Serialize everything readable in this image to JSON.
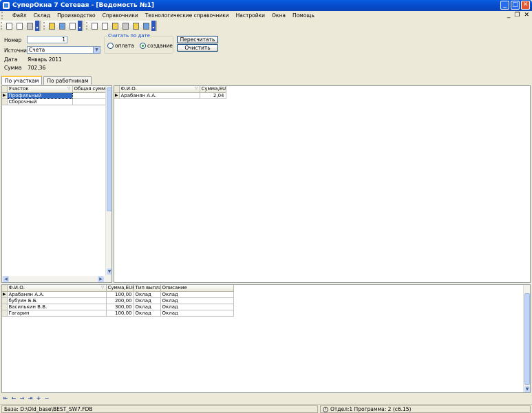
{
  "window": {
    "title": "СуперОкна 7 Сетевая - [Ведомость №1]",
    "minimize": "_",
    "maximize": "□",
    "close": "✕",
    "mdi_min": "_",
    "mdi_restore": "❐",
    "mdi_close": "✕"
  },
  "menu": [
    "Файл",
    "Склад",
    "Производство",
    "Справочники",
    "Технологические справочники",
    "Настройки",
    "Окна",
    "Помощь"
  ],
  "form": {
    "number_label": "Номер",
    "number_value": "1",
    "source_label": "Источник",
    "source_value": "Счета",
    "date_label": "Дата",
    "date_value": "Январь 2011",
    "sum_label": "Сумма",
    "sum_value": "702,36",
    "group_title": "Считать по дате",
    "radio_payment": "оплата",
    "radio_creation": "создание",
    "radio_selected": "создание",
    "recalc_button": "Пересчитать",
    "clear_button": "Очистить"
  },
  "tabs": [
    {
      "label": "По участкам",
      "active": true
    },
    {
      "label": "По работникам",
      "active": false
    }
  ],
  "sections_grid": {
    "columns": [
      "Участок",
      "Общая сумма,EUR"
    ],
    "rows": [
      {
        "name": "Профильный",
        "total": "",
        "selected": true
      },
      {
        "name": "Сборочный",
        "total": "",
        "selected": false
      }
    ]
  },
  "workers_grid": {
    "columns": [
      "Ф.И.О.",
      "Сумма,EUR"
    ],
    "rows": [
      {
        "name": "Арабанян А.А.",
        "sum": "2,04"
      }
    ]
  },
  "payments_grid": {
    "columns": [
      "Ф.И.О.",
      "Сумма,EUR",
      "Тип выплат",
      "Описание"
    ],
    "rows": [
      {
        "name": "Арабанян А.А.",
        "sum": "100,00",
        "type": "Оклад",
        "desc": "Оклад"
      },
      {
        "name": "бубуин Б.Б.",
        "sum": "200,00",
        "type": "Оклад",
        "desc": "Оклад"
      },
      {
        "name": "Василькин В.В.",
        "sum": "300,00",
        "type": "Оклад",
        "desc": "Оклад"
      },
      {
        "name": "Гагарин",
        "sum": "100,00",
        "type": "Оклад",
        "desc": "Оклад"
      }
    ]
  },
  "navigator": [
    "⇤",
    "←",
    "→",
    "⇥",
    "+",
    "−"
  ],
  "status": {
    "db": "База: D:\\Old_base\\BEST_SW7.FDB",
    "info": "Отдел:1 Программа: 2 (с6.15)"
  }
}
